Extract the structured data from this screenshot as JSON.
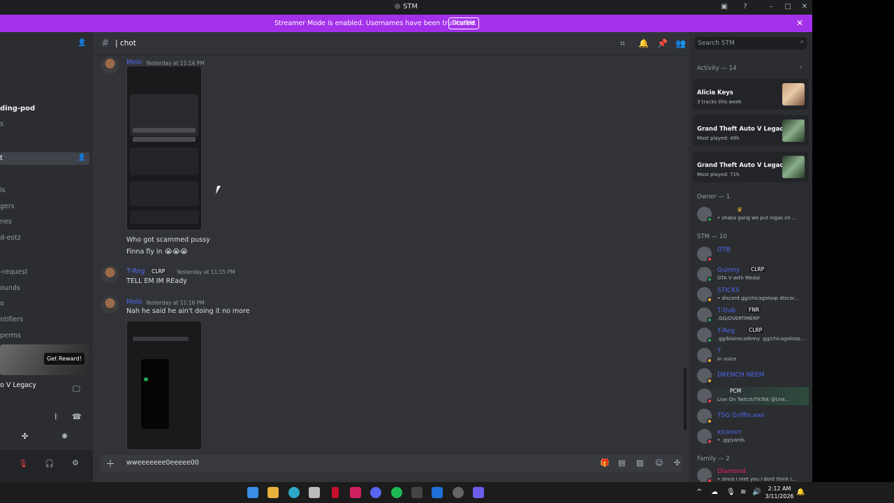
{
  "window": {
    "title": "STM"
  },
  "banner": {
    "message": "Streamer Mode is enabled. Usernames have been truncated.",
    "disable_label": "Disable",
    "color": "#a431ea"
  },
  "sidebar": {
    "server_item": "ding-pod",
    "channels": [
      "s",
      "t",
      "ls",
      "gers",
      "nes",
      "d-eotz",
      "-request",
      "ounds",
      "o",
      "ntifiers",
      "perms"
    ],
    "selected_channel": "t",
    "reward_button": "Get Reward!",
    "activity_game": "o V Legacy"
  },
  "chat": {
    "channel_name": "| chot",
    "messages": [
      {
        "author": "Melo",
        "timestamp": "Yesterday at 11:14 PM",
        "lines": [
          "Who got scammed pussy",
          "Finna fly in 😭😭😭"
        ]
      },
      {
        "author": "T-Reg",
        "tag": "CLRP",
        "timestamp": "Yesterday at 11:15 PM",
        "lines": [
          "TELL EM IM REady"
        ]
      },
      {
        "author": "Melo",
        "timestamp": "Yesterday at 11:16 PM",
        "lines": [
          "Nah he said he ain't doing it no more"
        ]
      }
    ],
    "composer_text": "wweeeeeee0eeeee00"
  },
  "members": {
    "search_placeholder": "Search STM",
    "activity_header": "Activity — 14",
    "activity_cards": [
      {
        "title": "Alicia Keys",
        "subtitle": "3 tracks this week"
      },
      {
        "title": "Grand Theft Auto V Legacy",
        "subtitle": "Most played: 49h"
      },
      {
        "title": "Grand Theft Auto V Legacy",
        "subtitle": "Most played: 71h"
      }
    ],
    "owner_header": "Owner — 1",
    "owner": {
      "status": "• shaka gang we put nigas on ..."
    },
    "stm_header": "STM — 10",
    "stm_members": [
      {
        "name": "OTB",
        "tag": "",
        "status": ""
      },
      {
        "name": "Quinny",
        "tag": "CLRP",
        "status": "GTA V with Medal"
      },
      {
        "name": "STICKS",
        "tag": "",
        "status": "• discord.gg/chicagoloop discor..."
      },
      {
        "name": "T-Dub",
        "tag": "FNR",
        "status": ".GG/OVERTIMERP"
      },
      {
        "name": "T-Reg",
        "tag": "CLRP",
        "status": ".gg/blairacademy .gg/chicagoloop..."
      },
      {
        "name": "T",
        "tag": "",
        "status": "In voice"
      },
      {
        "name": "DRENCH NEEM",
        "tag": "",
        "status": ""
      },
      {
        "name": "",
        "tag": "PCM",
        "status": "Live On Twitch/TikTok @Unk..."
      },
      {
        "name": "TSG Griffin.exe",
        "tag": "",
        "status": ""
      },
      {
        "name": "ᴋɪᴄᴋᴏᴜᴛ",
        "tag": "",
        "status": "• .gg/yards"
      }
    ],
    "family_header": "Family — 2",
    "family_members": [
      {
        "name": "Diamond",
        "status": "• since i met you i dont think i..."
      }
    ]
  },
  "taskbar": {
    "time": "2:12 AM",
    "date": "3/11/2026"
  }
}
